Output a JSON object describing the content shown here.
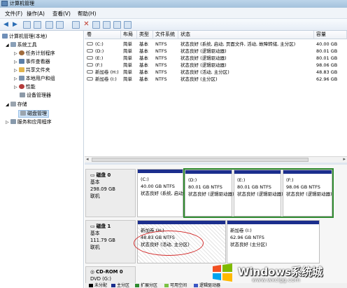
{
  "window": {
    "title": "计算机管理"
  },
  "menu": [
    "文件(F)",
    "操作(A)",
    "查看(V)",
    "帮助(H)"
  ],
  "tree": {
    "root": "计算机管理(本地)",
    "system_tools": "系统工具",
    "task_scheduler": "任务计划程序",
    "event_viewer": "事件查看器",
    "shared_folders": "共享文件夹",
    "local_users": "本地用户和组",
    "performance": "性能",
    "device_manager": "设备管理器",
    "storage": "存储",
    "disk_management": "磁盘管理",
    "services_apps": "服务和应用程序"
  },
  "volumes": {
    "columns": [
      "卷",
      "布局",
      "类型",
      "文件系统",
      "状态",
      "容量"
    ],
    "rows": [
      {
        "volume": "(C:)",
        "layout": "简单",
        "type": "基本",
        "fs": "NTFS",
        "status": "状态良好 (系统, 启动, 页面文件, 活动, 故障转储, 主分区)",
        "capacity": "40.00 GB"
      },
      {
        "volume": "(D:)",
        "layout": "简单",
        "type": "基本",
        "fs": "NTFS",
        "status": "状态良好 (逻辑驱动器)",
        "capacity": "80.01 GB"
      },
      {
        "volume": "(E:)",
        "layout": "简单",
        "type": "基本",
        "fs": "NTFS",
        "status": "状态良好 (逻辑驱动器)",
        "capacity": "80.01 GB"
      },
      {
        "volume": "(F:)",
        "layout": "简单",
        "type": "基本",
        "fs": "NTFS",
        "status": "状态良好 (逻辑驱动器)",
        "capacity": "98.06 GB"
      },
      {
        "volume": "新加卷 (H:)",
        "layout": "简单",
        "type": "基本",
        "fs": "NTFS",
        "status": "状态良好 (活动, 主分区)",
        "capacity": "48.83 GB"
      },
      {
        "volume": "新加卷 (I:)",
        "layout": "简单",
        "type": "基本",
        "fs": "NTFS",
        "status": "状态良好 (主分区)",
        "capacity": "62.96 GB"
      }
    ]
  },
  "disks": [
    {
      "name": "磁盘 0",
      "kind": "基本",
      "size": "298.09 GB",
      "state": "联机",
      "partitions": [
        {
          "label": "(C:)",
          "size": "40.00 GB NTFS",
          "status": "状态良好 (系统, 启动"
        },
        {
          "label": "(D:)",
          "size": "80.01 GB NTFS",
          "status": "状态良好 (逻辑驱动器)"
        },
        {
          "label": "(E:)",
          "size": "80.01 GB NTFS",
          "status": "状态良好 (逻辑驱动器)"
        },
        {
          "label": "(F:)",
          "size": "98.06 GB NTFS",
          "status": "状态良好 (逻辑驱动器)"
        }
      ]
    },
    {
      "name": "磁盘 1",
      "kind": "基本",
      "size": "111.79 GB",
      "state": "联机",
      "partitions": [
        {
          "label": "新加卷 (H:)",
          "size": "48.83 GB NTFS",
          "status": "状态良好 (活动, 主分区)"
        },
        {
          "label": "新加卷 (I:)",
          "size": "62.96 GB NTFS",
          "status": "状态良好 (主分区)"
        }
      ]
    },
    {
      "name": "CD-ROM 0",
      "kind": "DVD (G:)"
    }
  ],
  "legend": [
    "未分配",
    "主分区",
    "扩展分区",
    "可用空间",
    "逻辑驱动器"
  ],
  "watermark": {
    "text": "Windows系统城",
    "url": "www.wxclgg.com"
  },
  "colors": {
    "partition_bar": "#1b2e8d",
    "selection": "#2f8b2f",
    "annotation": "#d32b2b"
  }
}
